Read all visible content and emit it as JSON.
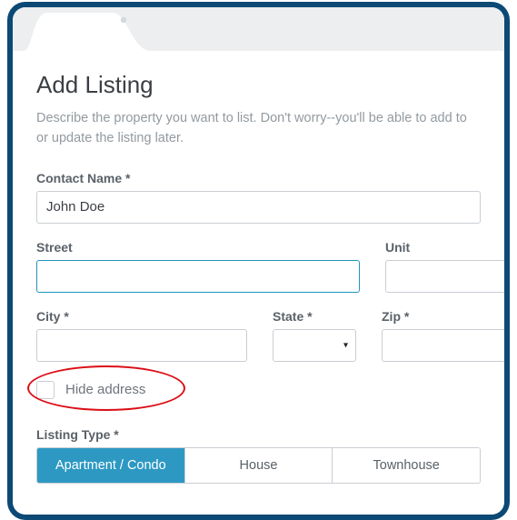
{
  "page": {
    "title": "Add Listing",
    "subtitle": "Describe the property you want to list. Don't worry--you'll be able to add to or update the listing later."
  },
  "fields": {
    "contact_name": {
      "label": "Contact Name *",
      "value": "John Doe"
    },
    "street": {
      "label": "Street",
      "value": ""
    },
    "unit": {
      "label": "Unit",
      "value": ""
    },
    "city": {
      "label": "City *",
      "value": ""
    },
    "state": {
      "label": "State *",
      "value": ""
    },
    "zip": {
      "label": "Zip *",
      "value": ""
    },
    "hide_address": {
      "label": "Hide address",
      "checked": false
    },
    "listing_type": {
      "label": "Listing Type *",
      "options": [
        "Apartment / Condo",
        "House",
        "Townhouse"
      ],
      "selected": "Apartment / Condo"
    }
  },
  "colors": {
    "frame": "#0c4975",
    "accent": "#2d99c3",
    "annotation": "#dc0e16"
  }
}
